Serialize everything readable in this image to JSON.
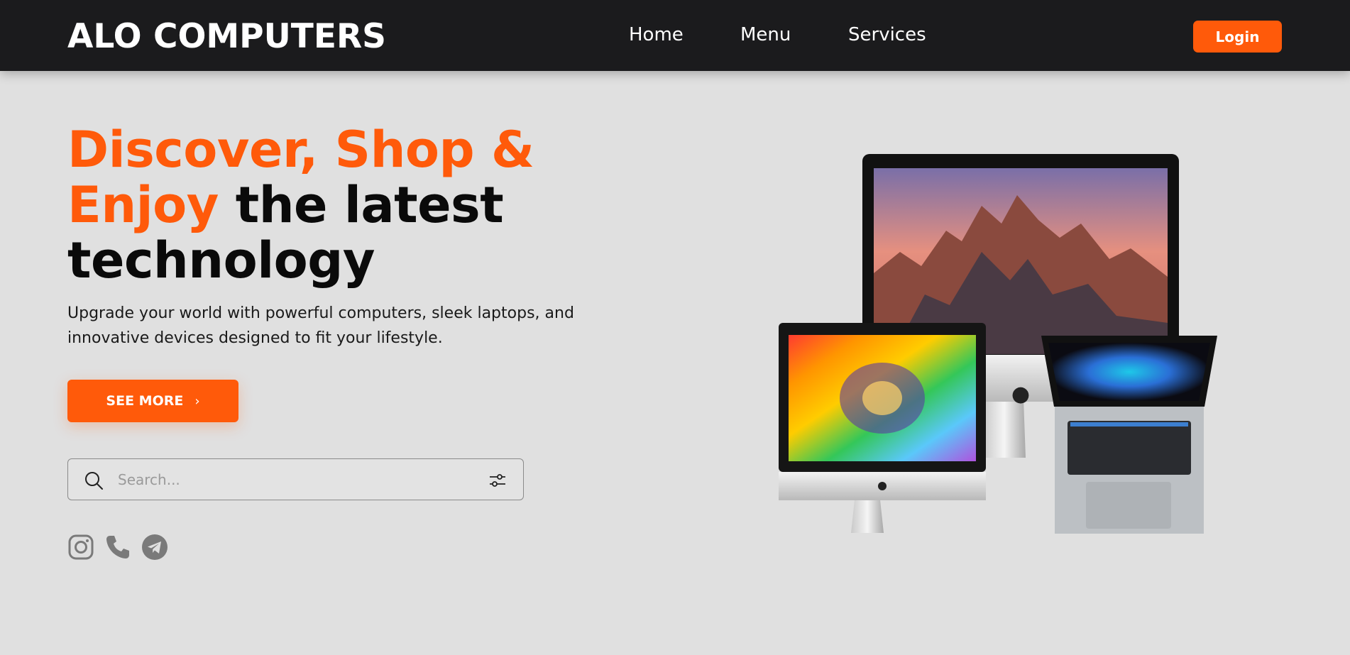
{
  "header": {
    "brand": "ALO COMPUTERS",
    "nav": [
      "Home",
      "Menu",
      "Services"
    ],
    "login_label": "Login"
  },
  "hero": {
    "headline_accent_1": "Discover, Shop &",
    "headline_accent_2": "Enjoy",
    "headline_rest_1": "the latest",
    "headline_rest_2": "technology",
    "subtext": "Upgrade your world with powerful computers, sleek laptops, and innovative devices designed to fit your lifestyle.",
    "cta_label": "SEE MORE",
    "cta_icon": "chevron-right-icon"
  },
  "search": {
    "placeholder": "Search...",
    "value": "",
    "icons": [
      "search-icon",
      "filter-sliders-icon"
    ]
  },
  "socials": [
    "instagram-icon",
    "phone-icon",
    "telegram-icon"
  ],
  "hero_image": {
    "devices": [
      "imac-large",
      "imac-small",
      "macbook-pro"
    ]
  },
  "colors": {
    "accent": "#ff5a0a",
    "header_bg": "#1b1b1d",
    "page_bg": "#e0e0e0",
    "icon_gray": "#7a7a7a"
  }
}
